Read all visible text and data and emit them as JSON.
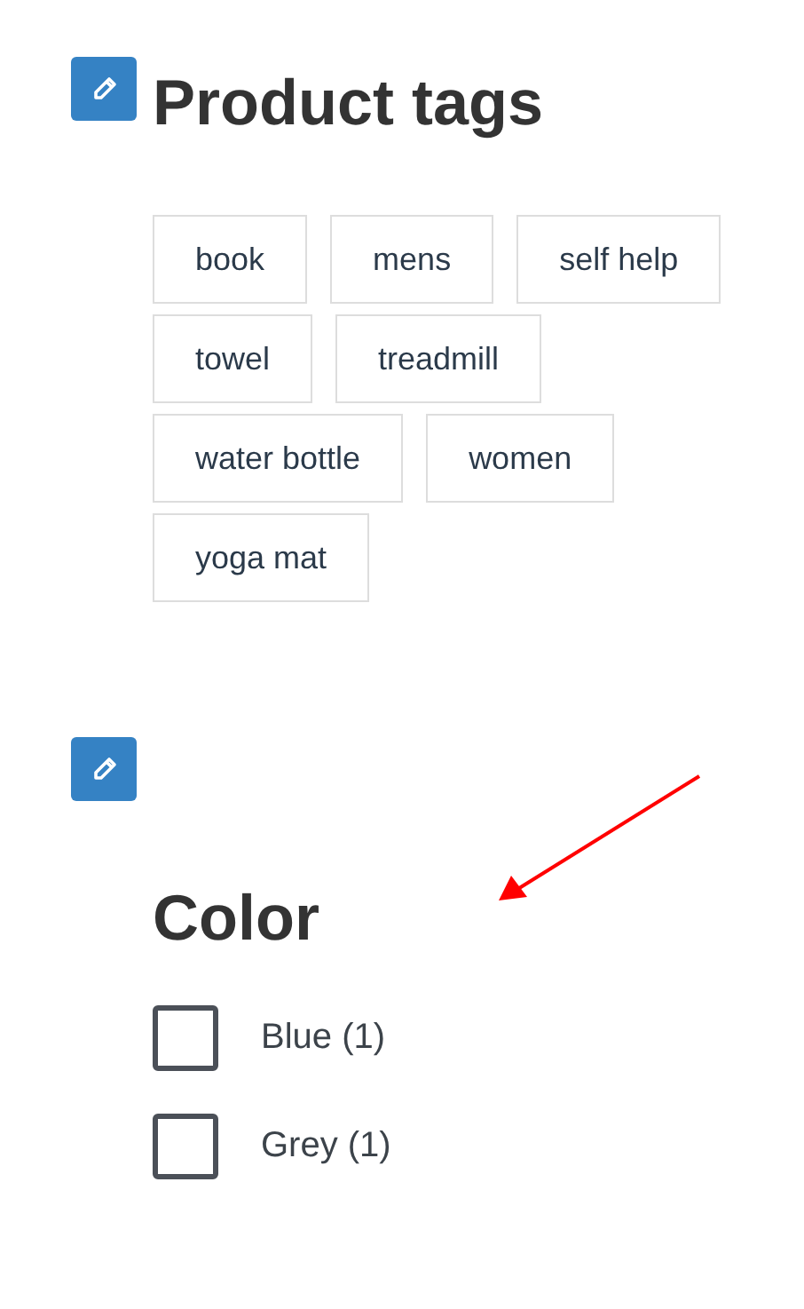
{
  "product_tags": {
    "title": "Product tags",
    "tags": [
      {
        "label": "book"
      },
      {
        "label": "mens"
      },
      {
        "label": "self help"
      },
      {
        "label": "towel"
      },
      {
        "label": "treadmill"
      },
      {
        "label": "water bottle"
      },
      {
        "label": "women"
      },
      {
        "label": "yoga mat"
      }
    ]
  },
  "color_filter": {
    "title": "Color",
    "options": [
      {
        "label": "Blue (1)",
        "checked": false
      },
      {
        "label": "Grey (1)",
        "checked": false
      }
    ]
  }
}
